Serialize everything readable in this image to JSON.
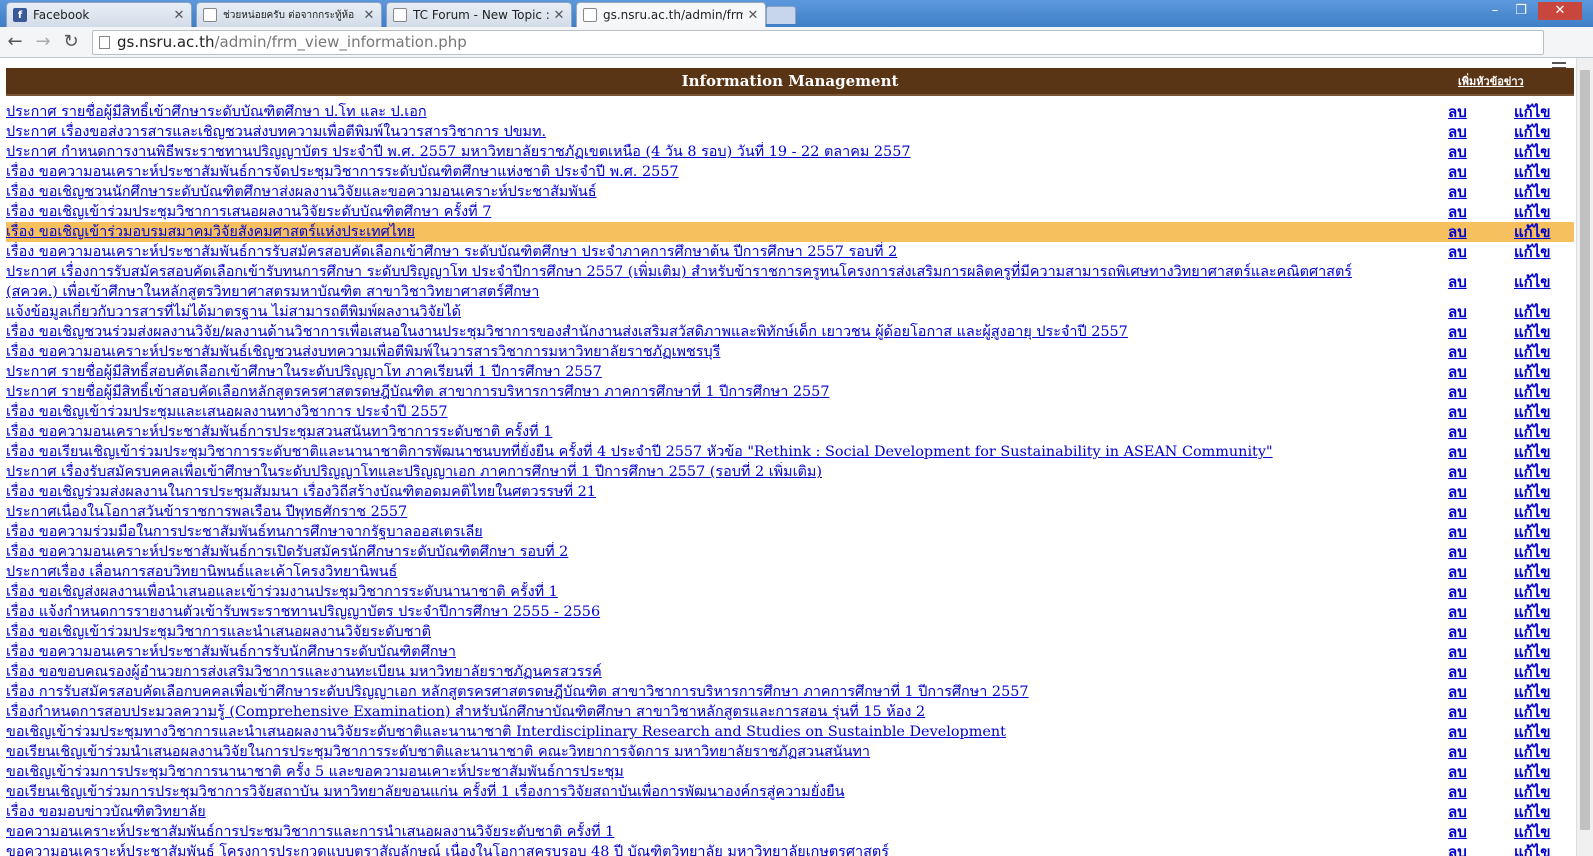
{
  "browser": {
    "tabs": [
      {
        "title": "Facebook",
        "icon": "facebook-icon"
      },
      {
        "title": "ช่วยหน่อยครับ  ต่อจากกระทู้ห้อ",
        "icon": "page-icon"
      },
      {
        "title": "TC Forum - New Topic :: :",
        "icon": "page-icon"
      },
      {
        "title": "gs.nsru.ac.th/admin/frm_",
        "icon": "page-icon"
      }
    ],
    "url_host": "gs.nsru.ac.th",
    "url_path": "/admin/frm_view_information.php"
  },
  "page": {
    "title": "Information Management",
    "add_link": "เพิ่มหัวข้อข่าว",
    "delete_label": "ลบ",
    "edit_label": "แก้ไข",
    "highlight_color": "#f7c05e",
    "header_color": "#5a3515",
    "items": [
      "ประกาศ รายชื่อผู้มีสิทธิ์เข้าศึกษาระดับบัณฑิตศึกษา ป.โท และ ป.เอก",
      "ประกาศ เรื่องขอส่งวารสารและเชิญชวนส่งบทความเพื่อตีพิมพ์ในวารสารวิชาการ ปขมท.",
      "ประกาศ กำหนดการงานพิธีพระราชทานปริญญาบัตร ประจำปี พ.ศ. 2557 มหาวิทยาลัยราชภัฏเขตเหนือ (4 วัน 8 รอบ) วันที่ 19 - 22 ตลาคม 2557",
      "เรื่อง ขอความอนเคราะห์ประชาสัมพันธ์การจัดประชุมวิชาการระดับบัณฑิตศึกษาแห่งชาติ ประจำปี พ.ศ. 2557",
      "เรื่อง ขอเชิญชวนนักศึกษาระดับบัณฑิตศึกษาส่งผลงานวิจัยและขอความอนเคราะห์ประชาสัมพันธ์",
      "เรื่อง ขอเชิญเข้าร่วมประชุมวิชาการเสนอผลงานวิจัยระดับบัณฑิตศึกษา ครั้งที่ 7",
      "เรื่อง ขอเชิญเข้าร่วมอบรมสมาคมวิจัยสังคมศาสตร์แห่งประเทศไทย",
      "เรื่อง ขอความอนเคราะห์ประชาสัมพันธ์การรับสมัครสอบคัดเลือกเข้าศึกษา ระดับบัณฑิตศึกษา ประจำภาคการศึกษาต้น ปีการศึกษา 2557 รอบที่ 2",
      "ประกาศ เรื่องการรับสมัครสอบคัดเลือกเข้ารับทนการศึกษา ระดับปริญญาโท ประจำปีการศึกษา 2557 (เพิ่มเติม) สำหรับข้าราชการครูทนโครงการส่งเสริมการผลิตครูที่มีความสามารถพิเศษทางวิทยาศาสตร์และคณิตศาสตร์ (สควค.) เพื่อเข้าศึกษาในหลักสูตรวิทยาศาสตรมหาบัณฑิต สาขาวิชาวิทยาศาสตร์ศึกษา",
      "แจ้งข้อมูลเกี่ยวกับวารสารที่ไม่ได้มาตรฐาน ไม่สามารถตีพิมพ์ผลงานวิจัยได้",
      "เรื่อง ขอเชิญชวนร่วมส่งผลงานวิจัย/ผลงานด้านวิชาการเพื่อเสนอในงานประชุมวิชาการของสำนักงานส่งเสริมสวัสดิภาพและพิทักษ์เด็ก เยาวชน ผู้ด้อยโอกาส และผู้สูงอายุ ประจำปี 2557",
      "เรื่อง ขอความอนเคราะห์ประชาสัมพันธ์เชิญชวนส่งบทความเพื่อตีพิมพ์ในวารสารวิชาการมหาวิทยาลัยราชภัฏเพชรบุรี",
      "ประกาศ รายชื่อผู้มีสิทธิ์สอบคัดเลือกเข้าศึกษาในระดับปริญญาโท ภาคเรียนที่ 1 ปีการศึกษา 2557",
      "ประกาศ รายชื่อผู้มีสิทธิ์เข้าสอบคัดเลือกหลักสูตรครศาสตรดษฎีบัณฑิต สาขาการบริหารการศึกษา ภาคการศึกษาที่ 1 ปีการศึกษา 2557",
      "เรื่อง ขอเชิญเข้าร่วมประชุมและเสนอผลงานทางวิชาการ ประจำปี 2557",
      "เรื่อง ขอความอนเคราะห์ประชาสัมพันธ์การประชุมสวนสนันทาวิชาการระดับชาติ ครั้งที่ 1",
      "เรื่อง ขอเรียนเชิญเข้าร่วมประชุมวิชาการระดับชาติและนานาชาติการพัฒนาชนบทที่ยั่งยืน ครั้งที่ 4 ประจำปี 2557 หัวข้อ \"Rethink : Social Development for Sustainability in ASEAN Community\"",
      "ประกาศ เรื่องรับสมัครบคคลเพื่อเข้าศึกษาในระดับปริญญาโทและปริญญาเอก ภาคการศึกษาที่ 1 ปีการศึกษา 2557 (รอบที่ 2 เพิ่มเติม)",
      "เรื่อง ขอเชิญร่วมส่งผลงานในการประชุมสัมมนา เรื่องวิถีสร้างบัณฑิตอดมคติไทยในศตวรรษที่ 21",
      "ประกาศเนื่องในโอกาสวันข้าราชการพลเรือน ปีพุทธศักราช 2557",
      "เรื่อง ขอความร่วมมือในการประชาสัมพันธ์ทนการศึกษาจากรัฐบาลออสเตรเลีย",
      "เรื่อง ขอความอนเคราะห์ประชาสัมพันธ์การเปิดรับสมัครนักศึกษาระดับบัณฑิตศึกษา รอบที่ 2",
      "ประกาศเรื่อง เลื่อนการสอบวิทยานิพนธ์และเค้าโครงวิทยานิพนธ์",
      "เรื่อง ขอเชิญส่งผลงานเพื่อนำเสนอและเข้าร่วมงานประชุมวิชาการระดับนานาชาติ ครั้งที่ 1",
      "เรื่อง แจ้งกำหนดการรายงานตัวเข้ารับพระราชทานปริญญาบัตร ประจำปีการศึกษา 2555 - 2556",
      "เรื่อง ขอเชิญเข้าร่วมประชุมวิชาการและนำเสนอผลงานวิจัยระดับชาติ",
      "เรื่อง ขอความอนเคราะห์ประชาสัมพันธ์การรับนักศึกษาระดับบัณฑิตศึกษา",
      "เรื่อง ขอขอบคณรองผู้อำนวยการส่งเสริมวิชาการและงานทะเบียน มหาวิทยาลัยราชภัฏนครสวรรค์",
      "เรื่อง การรับสมัครสอบคัดเลือกบคคลเพื่อเข้าศึกษาระดับปริญญาเอก หลักสูตรครศาสตรดษฎีบัณฑิต สาขาวิชาการบริหารการศึกษา ภาคการศึกษาที่ 1 ปีการศึกษา 2557",
      "เรื่องกำหนดการสอบประมวลความรู้ (Comprehensive Examination) สำหรับนักศึกษาบัณฑิตศึกษา สาขาวิชาหลักสูตรและการสอน รุ่นที่ 15 ห้อง 2",
      "ขอเชิญเข้าร่วมประชุมทางวิชาการและนำเสนอผลงานวิจัยระดับชาติและนานาชาติ Interdisciplinary Research and Studies on Sustainble Development",
      "ขอเรียนเชิญเข้าร่วมนำเสนอผลงานวิจัยในการประชุมวิชาการระดับชาติและนานาชาติ คณะวิทยาการจัดการ มหาวิทยาลัยราชภัฏสวนสนันทา",
      "ขอเชิญเข้าร่วมการประชุมวิชาการนานาชาติ ครั้ง 5 และขอความอนเคาะห์ประชาสัมพันธ์การประชุม",
      "ขอเรียนเชิญเข้าร่วมการประชุมวิชาการวิจัยสถาบัน มหาวิทยาลัยขอนแก่น ครั้งที่ 1 เรื่องการวิจัยสถาบันเพื่อการพัฒนาองค์กรสู่ความยั่งยืน",
      "เรื่อง ขอมอบข่าวบัณฑิตวิทยาลัย",
      "ขอความอนเคราะห์ประชาสัมพันธ์การประชมวิชาการและการนำเสนอผลงานวิจัยระดับชาติ ครั้งที่ 1",
      "ขอความอนเคราะห์ประชาสัมพันธ์ โครงการประกวดแบบตราสัญลักษณ์ เนื่องในโอกาสครบรอบ 48 ปี บัณฑิตวิทยาลัย มหาวิทยาลัยเกษตรศาสตร์"
    ]
  }
}
